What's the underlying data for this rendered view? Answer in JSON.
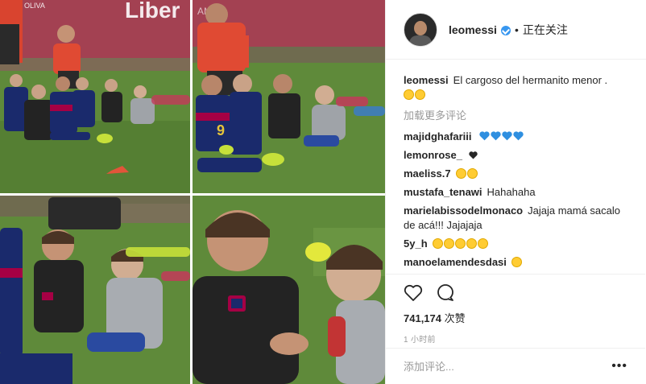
{
  "photo": {
    "banner_text": "Liber",
    "banner_text_small": "OLIVA",
    "tile_top_right_banner": "AMA",
    "jersey_number": "9"
  },
  "header": {
    "username": "leomessi",
    "separator": "•",
    "follow_status": "正在关注"
  },
  "caption": {
    "username": "leomessi",
    "text": "El cargoso del hermanito menor .",
    "emoji": [
      "face-with-tears-of-joy",
      "face-with-tears-of-joy"
    ]
  },
  "load_more": "加载更多评论",
  "comments": [
    {
      "username": "majidghafariii",
      "text": "",
      "emoji": [
        "blue-heart",
        "blue-heart",
        "blue-heart",
        "blue-heart"
      ]
    },
    {
      "username": "lemonrose_",
      "text": "",
      "emoji": [
        "black-heart"
      ]
    },
    {
      "username": "maeliss.7",
      "text": "",
      "emoji": [
        "face-with-tears-of-joy",
        "face-with-tears-of-joy"
      ]
    },
    {
      "username": "mustafa_tenawi",
      "text": "Hahahaha",
      "emoji": []
    },
    {
      "username": "marielabissodelmonaco",
      "text": "Jajaja mamá sacalo de acá!!! Jajajaja",
      "emoji": []
    },
    {
      "username": "5y_h",
      "text": "",
      "emoji": [
        "face-with-tears-of-joy",
        "face-with-tears-of-joy",
        "face-with-tears-of-joy",
        "face-with-tears-of-joy",
        "face-with-tears-of-joy"
      ]
    },
    {
      "username": "manoelamendesdasi",
      "text": "",
      "emoji": [
        "face-with-tears-of-joy"
      ]
    }
  ],
  "actions": {
    "like_icon": "heart-outline-icon",
    "comment_icon": "speech-bubble-icon",
    "likes_count": "741,174",
    "likes_unit": "次赞",
    "timestamp": "1 小时前"
  },
  "add_comment": {
    "placeholder": "添加评论...",
    "more_icon": "•••"
  },
  "colors": {
    "grass": "#5f8a3a",
    "banner": "#a34152",
    "barca_blue": "#1a2a6c",
    "barca_red": "#a50044",
    "verified_blue": "#3897f0",
    "emoji_heart_blue": "#2f8fe0"
  }
}
